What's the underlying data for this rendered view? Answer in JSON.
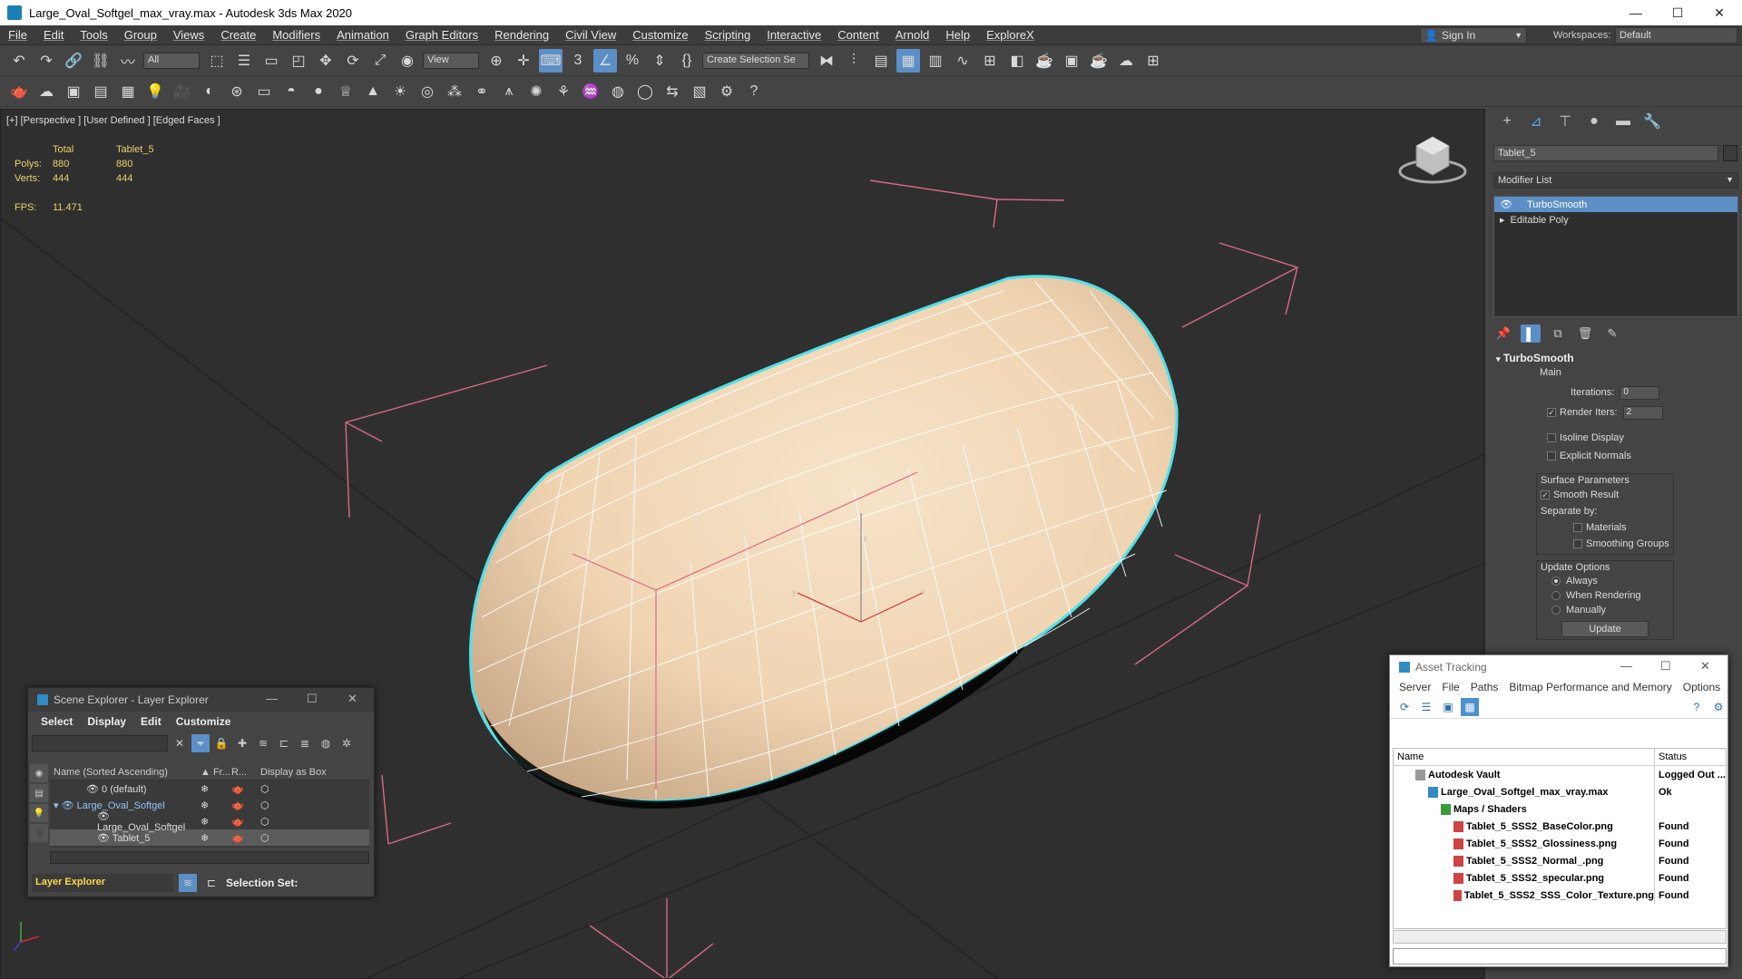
{
  "app": {
    "title": "Large_Oval_Softgel_max_vray.max - Autodesk 3ds Max 2020",
    "window_controls": [
      "—",
      "☐",
      "✕"
    ]
  },
  "menu": [
    "File",
    "Edit",
    "Tools",
    "Group",
    "Views",
    "Create",
    "Modifiers",
    "Animation",
    "Graph Editors",
    "Rendering",
    "Civil View",
    "Customize",
    "Scripting",
    "Interactive",
    "Content",
    "Arnold",
    "Help",
    "ExploreX"
  ],
  "signin": "Sign In",
  "workspaces": {
    "label": "Workspaces:",
    "value": "Default"
  },
  "toolbar": {
    "filter_value": "All",
    "ref_coord_value": "View",
    "selection_set_value": "Create Selection Se",
    "snap_value": "3"
  },
  "viewport": {
    "label": "[+] [Perspective ] [User Defined ] [Edged Faces ]",
    "stats": {
      "header_total": "Total",
      "header_obj": "Tablet_5",
      "polys_label": "Polys:",
      "polys_total": "880",
      "polys_obj": "880",
      "verts_label": "Verts:",
      "verts_total": "444",
      "verts_obj": "444",
      "fps_label": "FPS:",
      "fps_value": "11.471"
    },
    "gizmo_labels": [
      "z",
      "y",
      "x"
    ]
  },
  "cmd_panel": {
    "object_name": "Tablet_5",
    "modifier_list": "Modifier List",
    "stack": [
      "TurboSmooth",
      "Editable Poly"
    ],
    "rollout_title": "TurboSmooth",
    "main_label": "Main",
    "iterations_label": "Iterations:",
    "iterations_value": "0",
    "render_iters_label": "Render Iters:",
    "render_iters_value": "2",
    "isoline": "Isoline Display",
    "explicit_normals": "Explicit Normals",
    "surface_params": "Surface Parameters",
    "smooth_result": "Smooth Result",
    "separate_by": "Separate by:",
    "materials": "Materials",
    "smoothing_groups": "Smoothing Groups",
    "update_options": "Update Options",
    "always": "Always",
    "when_rendering": "When Rendering",
    "manually": "Manually",
    "update_button": "Update"
  },
  "scene_explorer": {
    "title": "Scene Explorer - Layer Explorer",
    "menu": [
      "Select",
      "Display",
      "Edit",
      "Customize"
    ],
    "columns": [
      "Name (Sorted Ascending)",
      "▲ Fr...",
      "R...",
      "Display as Box"
    ],
    "rows": [
      {
        "name": "0 (default)",
        "indent": 1
      },
      {
        "name": "Large_Oval_Softgel",
        "indent": 0
      },
      {
        "name": "Large_Oval_Softgel",
        "indent": 2
      },
      {
        "name": "Tablet_5",
        "indent": 2
      }
    ],
    "explorer_type": "Layer Explorer",
    "selection_set_label": "Selection Set:"
  },
  "asset_tracking": {
    "title": "Asset Tracking",
    "menu": [
      "Server",
      "File",
      "Paths",
      "Bitmap Performance and Memory",
      "Options"
    ],
    "columns": [
      "Name",
      "Status"
    ],
    "rows": [
      {
        "name": "Autodesk Vault",
        "status": "Logged Out ...",
        "level": 1
      },
      {
        "name": "Large_Oval_Softgel_max_vray.max",
        "status": "Ok",
        "level": 2
      },
      {
        "name": "Maps / Shaders",
        "status": "",
        "level": 3
      },
      {
        "name": "Tablet_5_SSS2_BaseColor.png",
        "status": "Found",
        "level": 4
      },
      {
        "name": "Tablet_5_SSS2_Glossiness.png",
        "status": "Found",
        "level": 4
      },
      {
        "name": "Tablet_5_SSS2_Normal_.png",
        "status": "Found",
        "level": 4
      },
      {
        "name": "Tablet_5_SSS2_specular.png",
        "status": "Found",
        "level": 4
      },
      {
        "name": "Tablet_5_SSS2_SSS_Color_Texture.png",
        "status": "Found",
        "level": 4
      }
    ]
  },
  "colors": {
    "accent": "#5b8fc6",
    "stats_text": "#e8d36a",
    "selection_outline": "#4fe1ea",
    "bounding_bracket": "#d86a86",
    "softgel": "#f1d8b8"
  }
}
